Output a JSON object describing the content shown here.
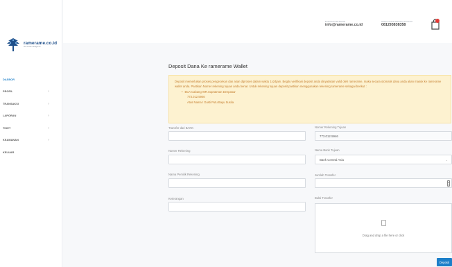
{
  "brand": {
    "name": "ramerame.co.id",
    "tagline": "the social intelligence",
    "logo_icon": "tree-icon",
    "accent": "#1c7fc9"
  },
  "header": {
    "email_label": "Email Kami Di Alamat",
    "email_value": "info@ramerame.co.id",
    "phone_label": "Telepon Kami Sekarang Di Nomor",
    "phone_value": "081293838358",
    "bag_icon": "shopping-bag-icon"
  },
  "sidebar": {
    "items": [
      {
        "label": "DASBOR",
        "chevron": ""
      },
      {
        "label": "PROFIL",
        "chevron": "›"
      },
      {
        "label": "TRANSAKSI",
        "chevron": "›"
      },
      {
        "label": "LAPORAN",
        "chevron": "›"
      },
      {
        "label": "TIKET",
        "chevron": "›"
      },
      {
        "label": "KEAMANAN",
        "chevron": "›"
      },
      {
        "label": "KELUAR",
        "chevron": ""
      }
    ]
  },
  "page": {
    "title": "Deposit Dana Ke ramerame Wallet",
    "notice": {
      "text": "Deposit memerlukan proses pengecekan dan akan diproses dalam waktu 1x24jam. Begitu verifikasi deposit anda dinyatakan valid oleh ramerame, maka secara otomatis dana anda akan masuk ke ramerame wallet anda. Pastikan Nomer rekening tujuan anda benar. Untuk rekening tujuan deposit pastikan menggunakan rekening ramerame sebagai berikut :",
      "bank": "BCA Cabang WR.Supratman Denpasar",
      "account": "773.012.5946",
      "holder": "Atas Nama I Gusti Putu Bayu Susila"
    },
    "form": {
      "transfer_from_label": "Transfer dari BANK",
      "transfer_from_value": "",
      "account_number_label": "Nomer Rekening",
      "account_number_value": "",
      "account_owner_label": "Nama Pemilik Rekening",
      "account_owner_value": "",
      "notes_label": "Keterangan",
      "notes_value": "",
      "dest_account_label": "Nomer Rekening Tujuan",
      "dest_account_value": "773.012.5946",
      "dest_bank_label": "Nama Bank Tujuan",
      "dest_bank_value": "Bank Central Asia",
      "amount_label": "Jumlah Transfer",
      "amount_value": "",
      "proof_label": "Bukti Transfer",
      "dropzone_text": "Drag and drop a file here or click",
      "submit_label": "Deposit"
    }
  }
}
